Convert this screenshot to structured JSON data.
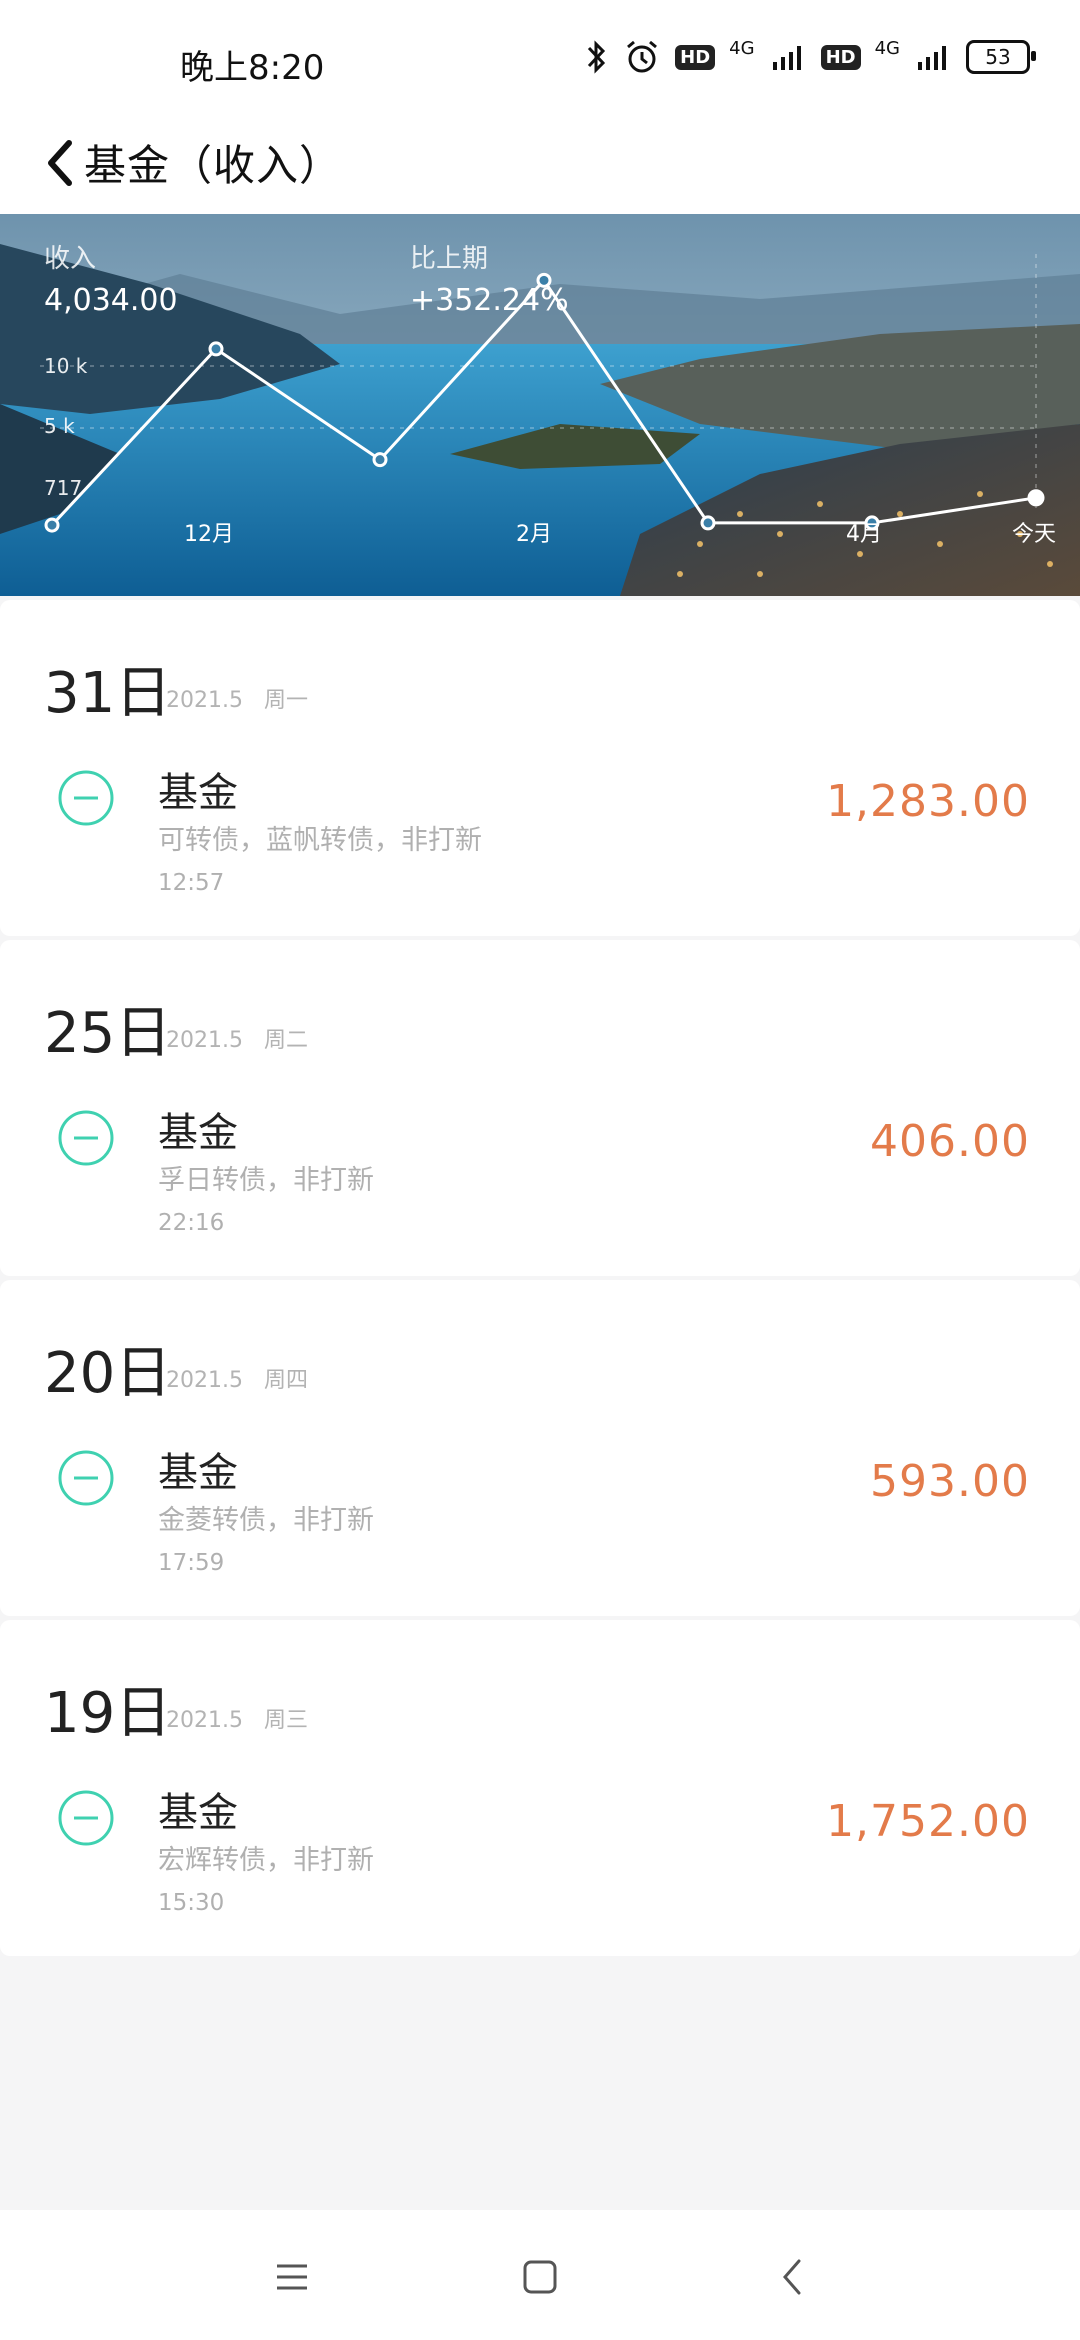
{
  "status_bar": {
    "time": "晚上8:20",
    "net_1": "4G",
    "net_2": "4G",
    "hd_1": "HD",
    "hd_2": "HD",
    "battery": "53"
  },
  "header": {
    "title": "基金（收入）"
  },
  "summary": {
    "income_label": "收入",
    "income_value": "4,034.00",
    "compare_label": "比上期",
    "compare_value": "+352.24%"
  },
  "chart_data": {
    "type": "line",
    "y_ticks": [
      "10 k",
      "5 k",
      "717"
    ],
    "x_labels": [
      "12月",
      "2月",
      "4月",
      "今天"
    ],
    "series": [
      {
        "values": [
          717,
          7400,
          3200,
          10000,
          800,
          800,
          1752
        ]
      }
    ],
    "ylim": [
      0,
      11000
    ]
  },
  "entries": [
    {
      "day": "31日",
      "date": "2021.5",
      "weekday": "周一",
      "title": "基金",
      "desc": "可转债，蓝帆转债，非打新",
      "time": "12:57",
      "amount": "1,283.00"
    },
    {
      "day": "25日",
      "date": "2021.5",
      "weekday": "周二",
      "title": "基金",
      "desc": "孚日转债，非打新",
      "time": "22:16",
      "amount": "406.00"
    },
    {
      "day": "20日",
      "date": "2021.5",
      "weekday": "周四",
      "title": "基金",
      "desc": "金菱转债，非打新",
      "time": "17:59",
      "amount": "593.00"
    },
    {
      "day": "19日",
      "date": "2021.5",
      "weekday": "周三",
      "title": "基金",
      "desc": "宏辉转债，非打新",
      "time": "15:30",
      "amount": "1,752.00"
    }
  ],
  "colors": {
    "amount": "#e37b4a",
    "icon": "#3fd1b0"
  }
}
